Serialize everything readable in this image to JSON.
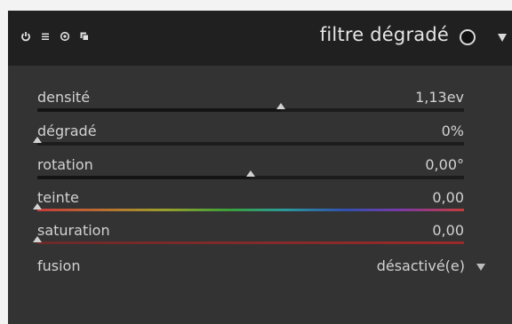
{
  "module": {
    "title": "filtre dégradé",
    "header_icons": [
      "power-icon",
      "menu-icon",
      "reset-icon",
      "duplicate-icon"
    ],
    "accent_color": "#d2d2d2"
  },
  "sliders": [
    {
      "id": "densite",
      "label": "densité",
      "value": "1,13ev",
      "level": 0.57
    },
    {
      "id": "degrade",
      "label": "dégradé",
      "value": "0%",
      "level": 0.0
    },
    {
      "id": "rotation",
      "label": "rotation",
      "value": "0,00°",
      "level": 0.5
    },
    {
      "id": "teinte",
      "label": "teinte",
      "value": "0,00",
      "level": 0.0
    },
    {
      "id": "saturation",
      "label": "saturation",
      "value": "0,00",
      "level": 0.0
    }
  ],
  "fusion": {
    "label": "fusion",
    "value": "désactivé(e)"
  }
}
